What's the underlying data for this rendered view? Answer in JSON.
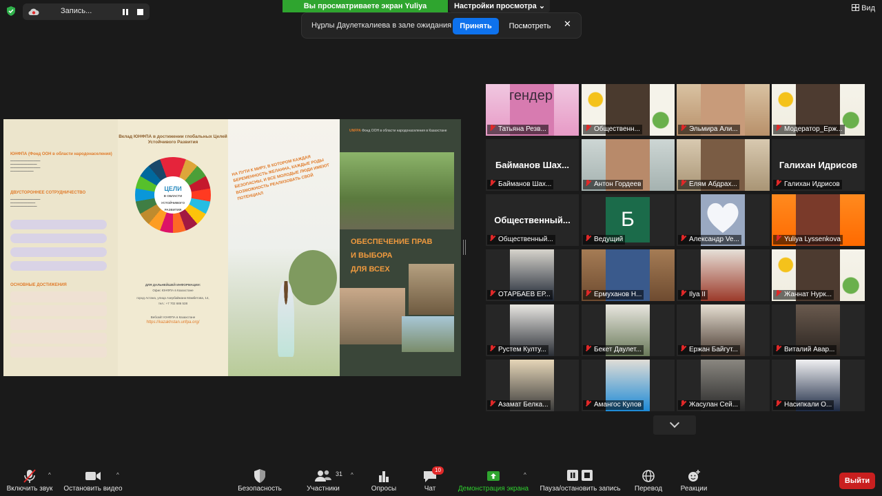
{
  "top": {
    "recording_label": "Запись...",
    "share_banner": "Вы просматриваете экран Yuliya Lyssenkova",
    "view_settings": "Настройки просмотра",
    "view_label": "Вид"
  },
  "notification": {
    "message": "Нұрлы Даулеткалиева в зале ожидания",
    "accept": "Принять",
    "view": "Посмотреть"
  },
  "shared": {
    "panel1_heading": "ЮНФПА (Фонд ООН в области народонаселения)",
    "panel1_coop": "ДВУСТОРОННЕЕ СОТРУДНИЧЕСТВО",
    "panel1_achievements": "ОСНОВНЫЕ ДОСТИЖЕНИЯ",
    "panel2_title": "Вклад ЮНФПА в достижении глобальных Целей Устойчивого Развития",
    "wheel_center": "ЦЕЛИ",
    "wheel_sub": "В ОБЛАСТИ УСТОЙЧИВОГО РАЗВИТИЯ",
    "panel2_info_heading": "ДЛЯ ДАЛЬНЕЙШЕЙ ИНФОРМАЦИИ:",
    "panel2_info_office": "Офис ЮНФПА в Казахстане",
    "panel2_info_address": "город Астана, улица Азербайжана Мамбетова, 14,",
    "panel2_info_tel": "тел.: +7 702 686 538",
    "panel2_website_label": "Вебсайт ЮНФПА в Казахстане",
    "panel2_link": "https://kazakhstan.unfpa.org/",
    "panel3_slogan": "НА ПУТИ К МИРУ, В КОТОРОМ КАЖДАЯ БЕРЕМЕННОСТЬ ЖЕЛАННА, КАЖДЫЕ РОДЫ БЕЗОПАСНЫ, И ВСЕ МОЛОДЫЕ ЛЮДИ ИМЕЮТ ВОЗМОЖНОСТЬ РЕАЛИЗОВАТЬ СВОЙ ПОТЕНЦИАЛ",
    "panel4_logo": "UNFPA",
    "panel4_logo_sub": "Фонд ООН в области народонаселения в Казахстане",
    "panel4_heading_lines": [
      "ОБЕСПЕЧЕНИЕ ПРАВ",
      "И ВЫБОРА",
      "ДЛЯ ВСЕХ"
    ]
  },
  "participants": [
    {
      "name": "Татьяна Резв...",
      "tag": "гендер"
    },
    {
      "name": "Общественн..."
    },
    {
      "name": "Эльмира Али..."
    },
    {
      "name": "Модератор_Ерж..."
    },
    {
      "name": "Байманов Шах...",
      "big": true
    },
    {
      "name": "Антон Гордеев"
    },
    {
      "name": "Елям Абдрах..."
    },
    {
      "name": "Галихан Идрисов",
      "big": true
    },
    {
      "name": "Общественный...",
      "big": true
    },
    {
      "name": "Ведущий",
      "avatar_letter": "Б"
    },
    {
      "name": "Александр Ve..."
    },
    {
      "name": "Yuliya Lyssenkova"
    },
    {
      "name": "ОТАРБАЕВ ЕР..."
    },
    {
      "name": "Ермуханов Н..."
    },
    {
      "name": "Ilya II"
    },
    {
      "name": "Жаннат Нурк..."
    },
    {
      "name": "Рустем Култу..."
    },
    {
      "name": "Бекет Даулет..."
    },
    {
      "name": "Ержан Байгут..."
    },
    {
      "name": "Виталий Авар..."
    },
    {
      "name": "Азамат Белка..."
    },
    {
      "name": "Амангос Кулов"
    },
    {
      "name": "Жасулан Сей..."
    },
    {
      "name": "Насипкали О..."
    }
  ],
  "toolbar": {
    "mic": "Включить звук",
    "video": "Остановить видео",
    "security": "Безопасность",
    "participants": "Участники",
    "participants_count": "31",
    "polls": "Опросы",
    "chat": "Чат",
    "chat_badge": "10",
    "share": "Демонстрация экрана",
    "record": "Пауза/остановить запись",
    "translate": "Перевод",
    "reactions": "Реакции",
    "exit": "Выйти"
  },
  "colors": {
    "share_green": "#2fa52f",
    "accept_blue": "#0e72ed",
    "exit_red": "#c91f1f",
    "muted_red": "#e02828",
    "active_speaker": "#bfcf2a"
  }
}
